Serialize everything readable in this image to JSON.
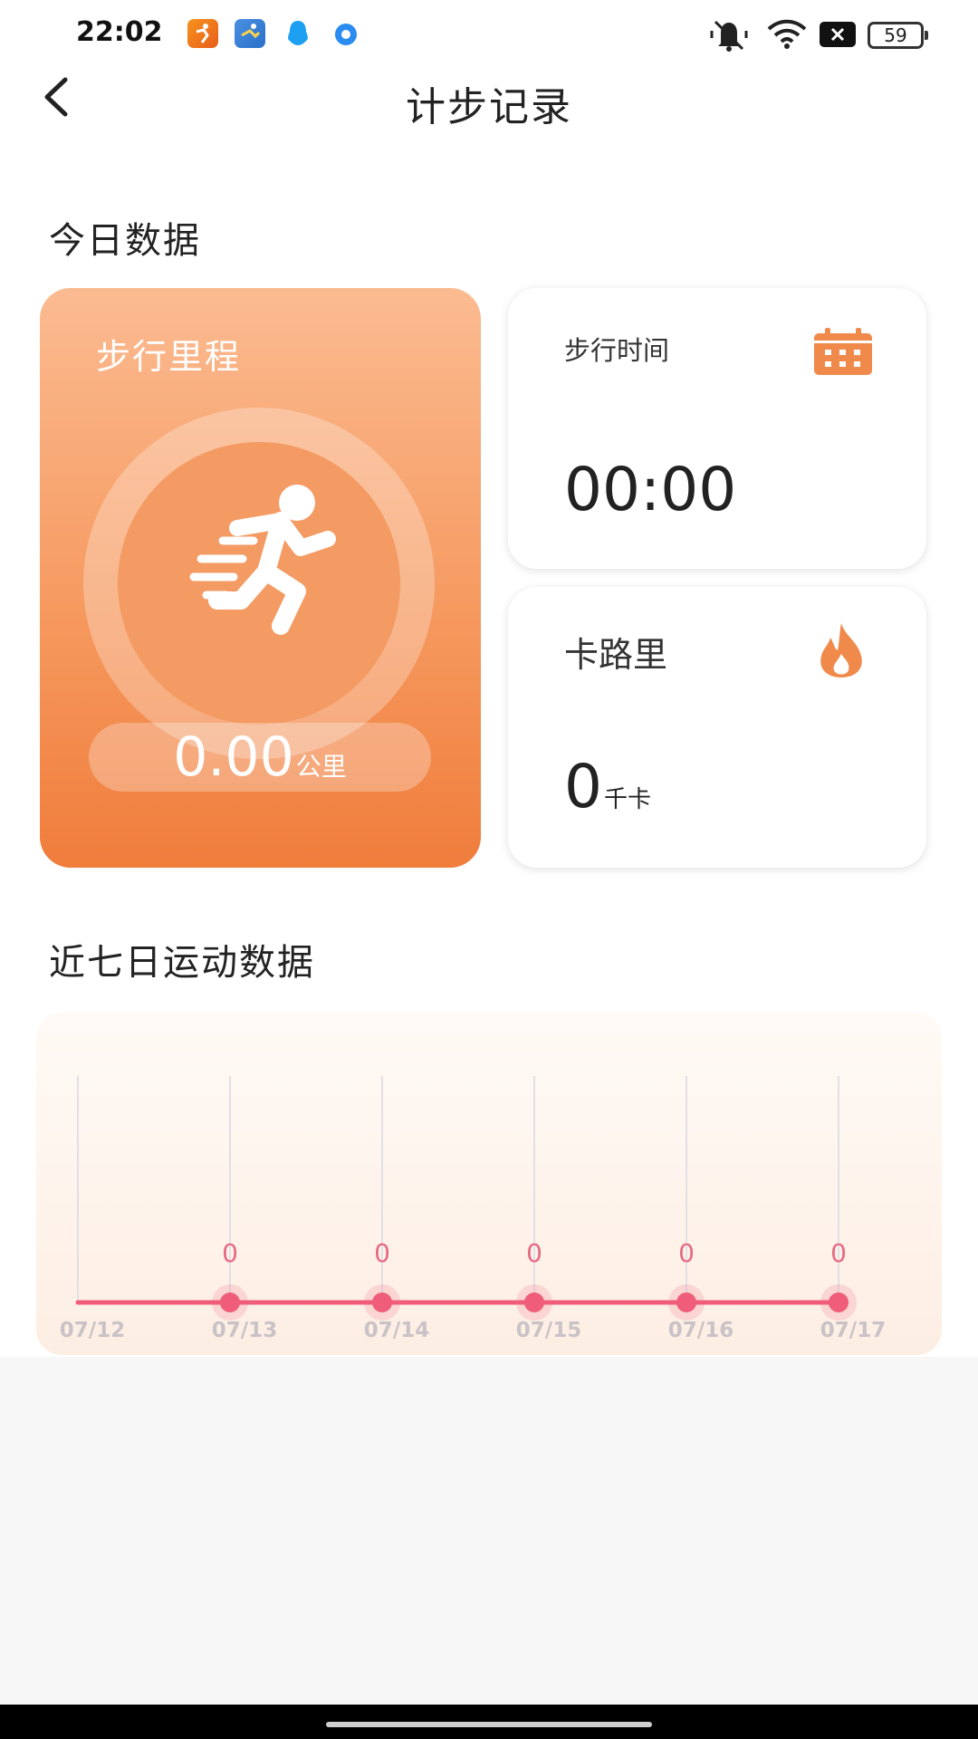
{
  "status_bar": {
    "time": "22:02",
    "battery": "59",
    "notification_icons": [
      "running-app-icon",
      "sports-app-icon",
      "qq-icon",
      "blue-dot-app-icon"
    ],
    "system_icons": [
      "mute-icon",
      "wifi-icon",
      "close-box-icon",
      "battery-icon"
    ]
  },
  "header": {
    "title": "计步记录",
    "back_icon": "chevron-left-icon"
  },
  "today": {
    "section_title": "今日数据",
    "distance": {
      "label": "步行里程",
      "value": "0.00",
      "unit": "公里",
      "icon": "runner-icon"
    },
    "walking_time": {
      "label": "步行时间",
      "value": "00:00",
      "icon": "calendar-icon"
    },
    "calories": {
      "label": "卡路里",
      "value": "0",
      "unit": "千卡",
      "icon": "flame-icon"
    }
  },
  "week": {
    "section_title": "近七日运动数据"
  },
  "colors": {
    "accent": "#f08a4b",
    "line": "#ef5d7a",
    "label": "#e76a85"
  },
  "chart_data": {
    "type": "line",
    "categories": [
      "07/12",
      "07/13",
      "07/14",
      "07/15",
      "07/16",
      "07/17"
    ],
    "values": [
      0,
      0,
      0,
      0,
      0,
      0
    ],
    "data_labels": [
      "",
      "0",
      "0",
      "0",
      "0",
      "0"
    ],
    "grid": true
  }
}
